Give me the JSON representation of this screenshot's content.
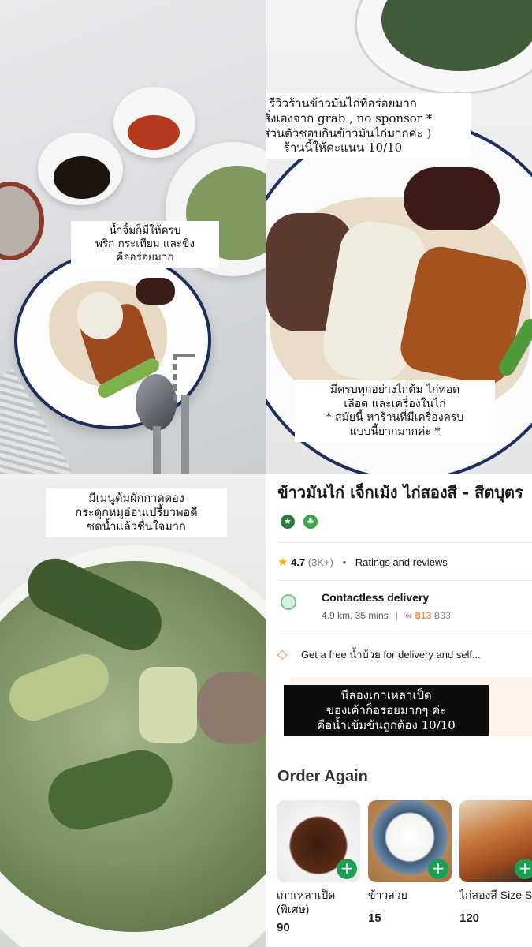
{
  "panel1": {
    "caption": [
      "น้ำจิ้มก็มีให้ครบ",
      "พริก กระเทียม และขิง",
      "คืออร่อยมาก"
    ]
  },
  "panel2": {
    "caption_top": [
      "รีวิวร้านข้าวมันไก่ที่อร่อยมาก",
      "* สั่งเองจาก grab , no sponsor *",
      "( ส่วนตัวชอบกินข้าวมันไก่มากค่ะ )",
      "ร้านนี้ให้คะแนน 10/10"
    ],
    "caption_bottom": [
      "มีครบทุกอย่างไก่ต้ม ไก่ทอด",
      "เลือด และเครื่องในไก่",
      "* สมัยนี้ หาร้านที่มีเครื่องครบ",
      "แบบนี้ยากมากค่ะ *"
    ]
  },
  "panel3": {
    "caption": [
      "มีเมนูต้มผักกาดดอง",
      "กระดูกหมูอ่อนเปรี้ยวพอดี",
      "ซดน้ำแล้วชื่นใจมาก"
    ]
  },
  "app": {
    "title": "ข้าวมันไก่ เจ็กเม้ง ไก่สองสี - สีตบุตร",
    "rating": "4.7",
    "rating_count": "(3K+)",
    "ratings_label": "Ratings and reviews",
    "delivery_title": "Contactless delivery",
    "delivery_meta": "4.9 km, 35 mins",
    "fee_new": "฿13",
    "fee_old": "฿33",
    "promo_text": "Get a free น้ำบ้วย for delivery and self...",
    "overlay_caption": [
      "นีลองเกาเหลาเป็ด",
      "ของเค้าก็อร่อยมากๆ ค่ะ",
      "คือน้ำเข้มข้นถูกต้อง 10/10"
    ],
    "order_again_label": "Order Again",
    "items": [
      {
        "name": "เกาเหลาเป็ด (พิเศษ)",
        "price": "90"
      },
      {
        "name": "ข้าวสวย",
        "price": "15"
      },
      {
        "name": "ไก่สองสี Size S",
        "price": "120"
      }
    ],
    "colors": {
      "accent": "#1f9d55",
      "star": "#f5b301",
      "fee": "#f37021"
    }
  }
}
